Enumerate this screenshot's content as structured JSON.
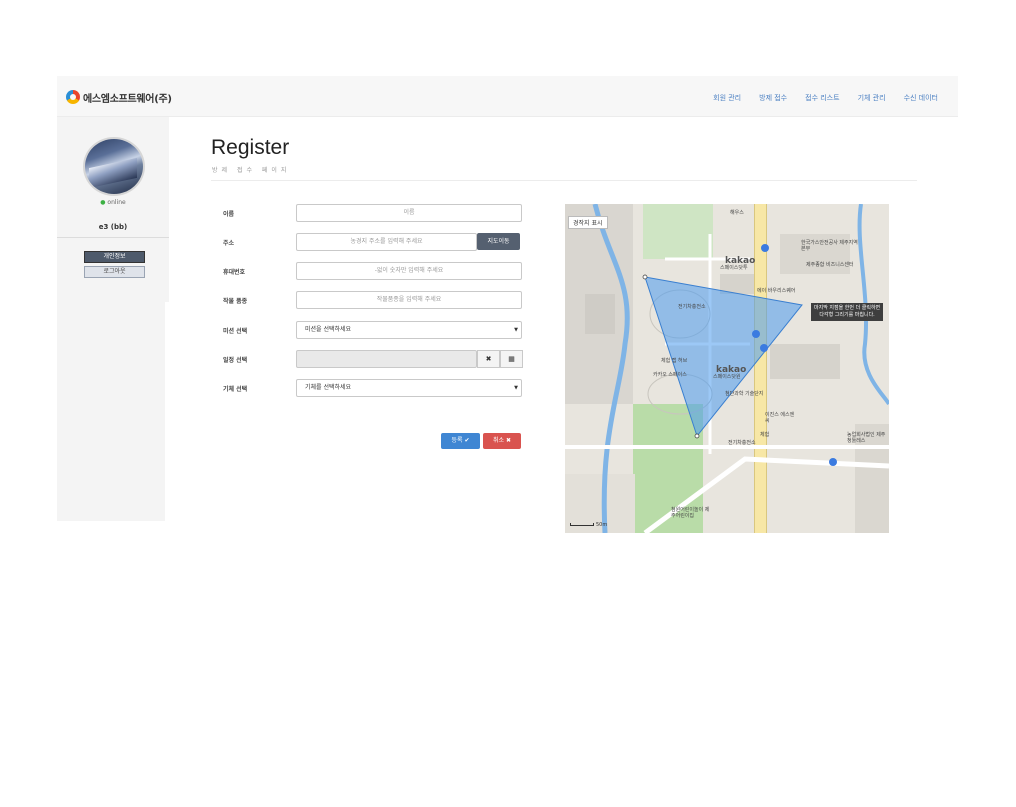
{
  "brand": {
    "name": "에스엠소프트웨어(주)"
  },
  "nav": [
    "회원 관리",
    "방제 접수",
    "접수 리스트",
    "기체 관리",
    "수신 데이터"
  ],
  "sidebar": {
    "status": "online",
    "username": "e3 (bb)",
    "buttons": [
      "개인정보",
      "로그아웃"
    ]
  },
  "page": {
    "title": "Register",
    "subtitle": "방제 접수 페이지"
  },
  "form": {
    "fields": [
      {
        "label": "이름",
        "placeholder": "이름"
      },
      {
        "label": "주소",
        "placeholder": "농경지 주소를 입력해 주세요",
        "button": "지도이동"
      },
      {
        "label": "휴대번호",
        "placeholder": "-없이 숫자만 입력해 주세요"
      },
      {
        "label": "작물 품종",
        "placeholder": "작물품종을 입력해 주세요"
      },
      {
        "label": "미션 선택",
        "value": "미션을 선택하세요"
      },
      {
        "label": "일정 선택",
        "value": ""
      },
      {
        "label": "기체 선택",
        "value": "기체를 선택하세요"
      }
    ],
    "submit_label": "등록 ✔",
    "cancel_label": "취소 ✖"
  },
  "map": {
    "toggle_label": "경작지 표시",
    "tooltip": "마지막 지점을 한번 더 클릭하면\n다각형 그리기를 마칩니다.",
    "logo": "kakao",
    "scale": "50m",
    "labels": {
      "busstop_top": "해우스",
      "gas": "한국가스안전공사 제주지역본부",
      "jeju_center": "제주종합 비즈니스센터",
      "camera": "에이 바우리스퀘어",
      "kakao_space1": "스페이스닷투",
      "kakao_space2": "스페이스닷원",
      "ev1": "전기차충전소",
      "ev2": "전기차충전소",
      "cafe": "카카오 스페이스",
      "dev": "체험 랩 허브",
      "ace": "이진스 에스엔씨",
      "edu": "체험",
      "agri": "농업회사법인 제주청툴레스",
      "school": "첨단과학 기술단지",
      "kinder": "첨원어린이놀이 제주어린이집"
    }
  },
  "colors": {
    "accent": "#3f86d3",
    "danger": "#d9534f",
    "polygon": "#5ea6f0"
  }
}
